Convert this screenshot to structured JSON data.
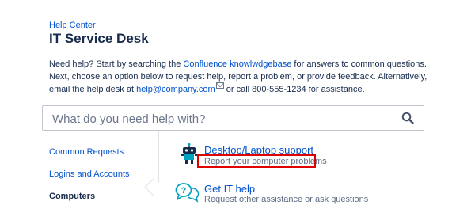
{
  "header": {
    "breadcrumb": "Help Center",
    "title": "IT Service Desk"
  },
  "intro": {
    "text1": "Need help? Start by searching the ",
    "kb_link": "Confluence knowlwdgebase",
    "text2": " for answers to common questions. Next, choose an option below to request help, report a problem, or provide feedback. Alternatively, email the help desk at ",
    "email_link": "help@company.com",
    "text3": " or call 800-555-1234 for assistance."
  },
  "search": {
    "placeholder": "What do you need help with?"
  },
  "nav": {
    "items": [
      {
        "label": "Common Requests",
        "active": false
      },
      {
        "label": "Logins and Accounts",
        "active": false
      },
      {
        "label": "Computers",
        "active": true
      }
    ]
  },
  "requests": [
    {
      "title": "Desktop/Laptop support",
      "description": "Report your computer problems",
      "icon": "robot-icon"
    },
    {
      "title": "Get IT help",
      "description": "Request other assistance or ask questions",
      "icon": "question-bubble-icon"
    }
  ],
  "colors": {
    "link": "#0052cc",
    "text": "#172b4d",
    "muted": "#5e6c84",
    "highlight": "#e10000",
    "icon_teal": "#00a3bf"
  }
}
